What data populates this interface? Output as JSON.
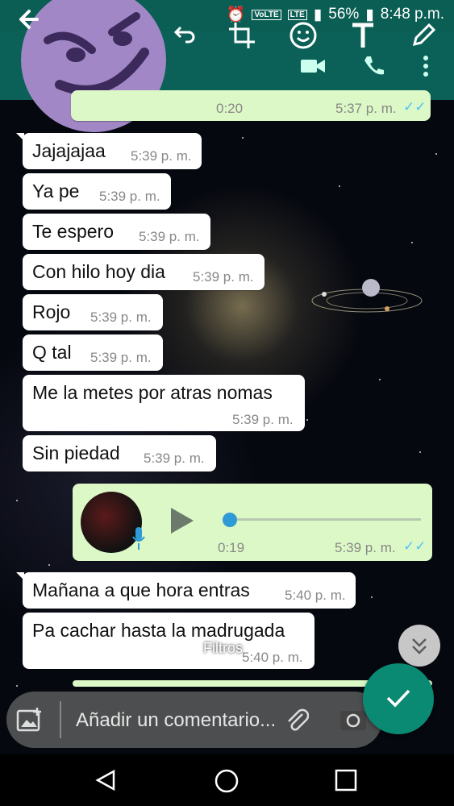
{
  "status_bar": {
    "volte": "VoLTE",
    "lte": "LTE",
    "battery": "56%",
    "time": "8:48 p.m."
  },
  "top_partial_message": {
    "duration": "0:20",
    "time": "5:37 p. m."
  },
  "messages": [
    {
      "text": "Jajajajaa",
      "time": "5:39 p. m."
    },
    {
      "text": "Ya pe",
      "time": "5:39 p. m."
    },
    {
      "text": "Te espero",
      "time": "5:39 p. m."
    },
    {
      "text": "Con hilo hoy dia",
      "time": "5:39 p. m."
    },
    {
      "text": "Rojo",
      "time": "5:39 p. m."
    },
    {
      "text": "Q tal",
      "time": "5:39 p. m."
    },
    {
      "text": "Me la metes por atras nomas",
      "time": "5:39 p. m."
    },
    {
      "text": "Sin piedad",
      "time": "5:39 p. m."
    }
  ],
  "voice_message": {
    "duration": "0:19",
    "time": "5:39 p. m.",
    "progress": 0.03
  },
  "messages2": [
    {
      "text": "Mañana a que hora entras",
      "time": "5:40 p. m."
    },
    {
      "text": "Pa cachar hasta la madrugada",
      "time": "5:40 p. m."
    }
  ],
  "filters_label": "Filtros",
  "input": {
    "placeholder": "Añadir un comentario..."
  },
  "colors": {
    "header": "#0b6157",
    "accent": "#0a8a73",
    "outgoing": "#dcf8c6",
    "tick": "#4fc3f7"
  }
}
